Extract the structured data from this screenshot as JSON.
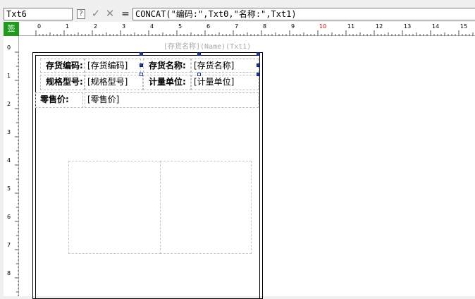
{
  "formula_bar": {
    "name_box": "Txt6",
    "help_icon": "?",
    "accept_icon": "✓",
    "cancel_icon": "✕",
    "equals": "=",
    "formula": "CONCAT(\"编码:\",Txt0,\"名称:\",Txt1)"
  },
  "ruler": {
    "corner_label": "签",
    "horizontal_marks": [
      "0",
      "1",
      "2",
      "3",
      "4",
      "5",
      "6",
      "7",
      "8",
      "9",
      "10",
      "11",
      "12",
      "13",
      "14",
      "15"
    ],
    "highlight_mark": "10",
    "highlight_color": "#d40000",
    "vertical_marks": [
      "0",
      "1",
      "2",
      "3",
      "4",
      "5",
      "6",
      "7",
      "8"
    ]
  },
  "report": {
    "header_field": "[存货名称](Name)(Txt1)",
    "row1": {
      "code_label": "存货编码:",
      "code_value": "[存货编码]",
      "name_label": "存货名称:",
      "name_value": "[存货名称]"
    },
    "row2": {
      "spec_label": "规格型号:",
      "spec_value": "[规格型号]",
      "unit_label": "计量单位:",
      "unit_value": "[计量单位]"
    },
    "row3": {
      "price_label": "零售价:",
      "price_value": "[零售价]"
    }
  },
  "colors": {
    "corner_green": "#1f9a1f",
    "selection_handle": "#1b3b9e"
  }
}
